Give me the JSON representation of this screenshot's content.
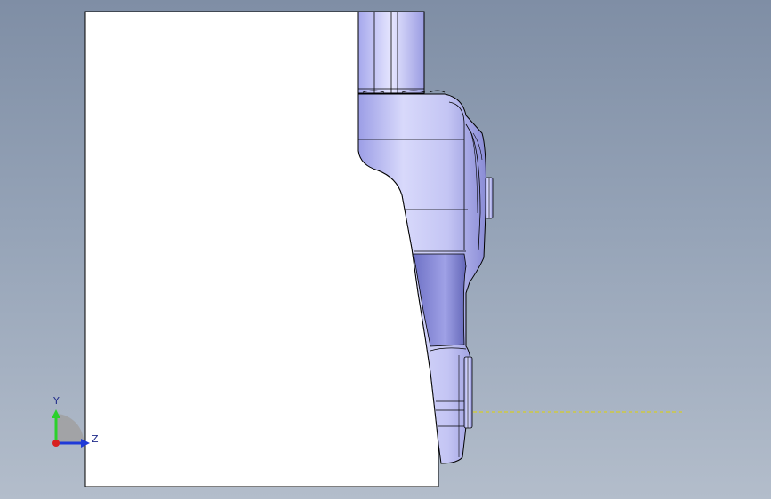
{
  "viewport": {
    "background_top": "#7f8ea5",
    "background_bottom": "#b3bdcb"
  },
  "model": {
    "body_color": "#ffffff",
    "edge_color": "#000000",
    "shaded_part_color": "#b8b9f0",
    "centerline_color": "#e0d400"
  },
  "triad": {
    "y_label": "Y",
    "z_label": "Z",
    "y_color": "#2bd12b",
    "z_color": "#1f3ad8",
    "origin_color": "#d81f1f"
  }
}
